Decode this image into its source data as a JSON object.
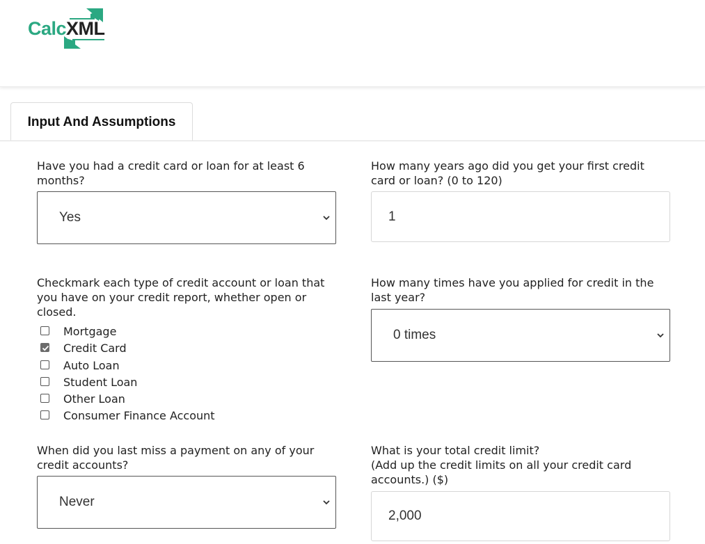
{
  "brand": {
    "logo_part1": "Calc",
    "logo_part2": "XML",
    "accent_color": "#2ba882"
  },
  "tabs": [
    {
      "label": "Input And Assumptions",
      "active": true
    }
  ],
  "form": {
    "q1": {
      "label": "Have you had a credit card or loan for at least 6 months?",
      "value": "Yes"
    },
    "q2": {
      "label": "How many years ago did you get your first credit card or loan? (0 to 120)",
      "value": "1"
    },
    "q3": {
      "label": "Checkmark each type of credit account or loan that you have on your credit report, whether open or closed.",
      "options": [
        {
          "label": "Mortgage",
          "checked": false
        },
        {
          "label": "Credit Card",
          "checked": true
        },
        {
          "label": "Auto Loan",
          "checked": false
        },
        {
          "label": "Student Loan",
          "checked": false
        },
        {
          "label": "Other Loan",
          "checked": false
        },
        {
          "label": "Consumer Finance Account",
          "checked": false
        }
      ]
    },
    "q4": {
      "label": "How many times have you applied for credit in the last year?",
      "value": "0 times"
    },
    "q5": {
      "label": "When did you last miss a payment on any of your credit accounts?",
      "value": "Never"
    },
    "q6": {
      "label_line1": "What is your total credit limit?",
      "label_line2": "(Add up the credit limits on all your credit card accounts.) ($)",
      "value": "2,000"
    }
  },
  "icons": {
    "select_arrow": "chevron-down-icon",
    "checkbox_check": "check-icon",
    "logo_arrows": "logo-arrows-icon"
  }
}
